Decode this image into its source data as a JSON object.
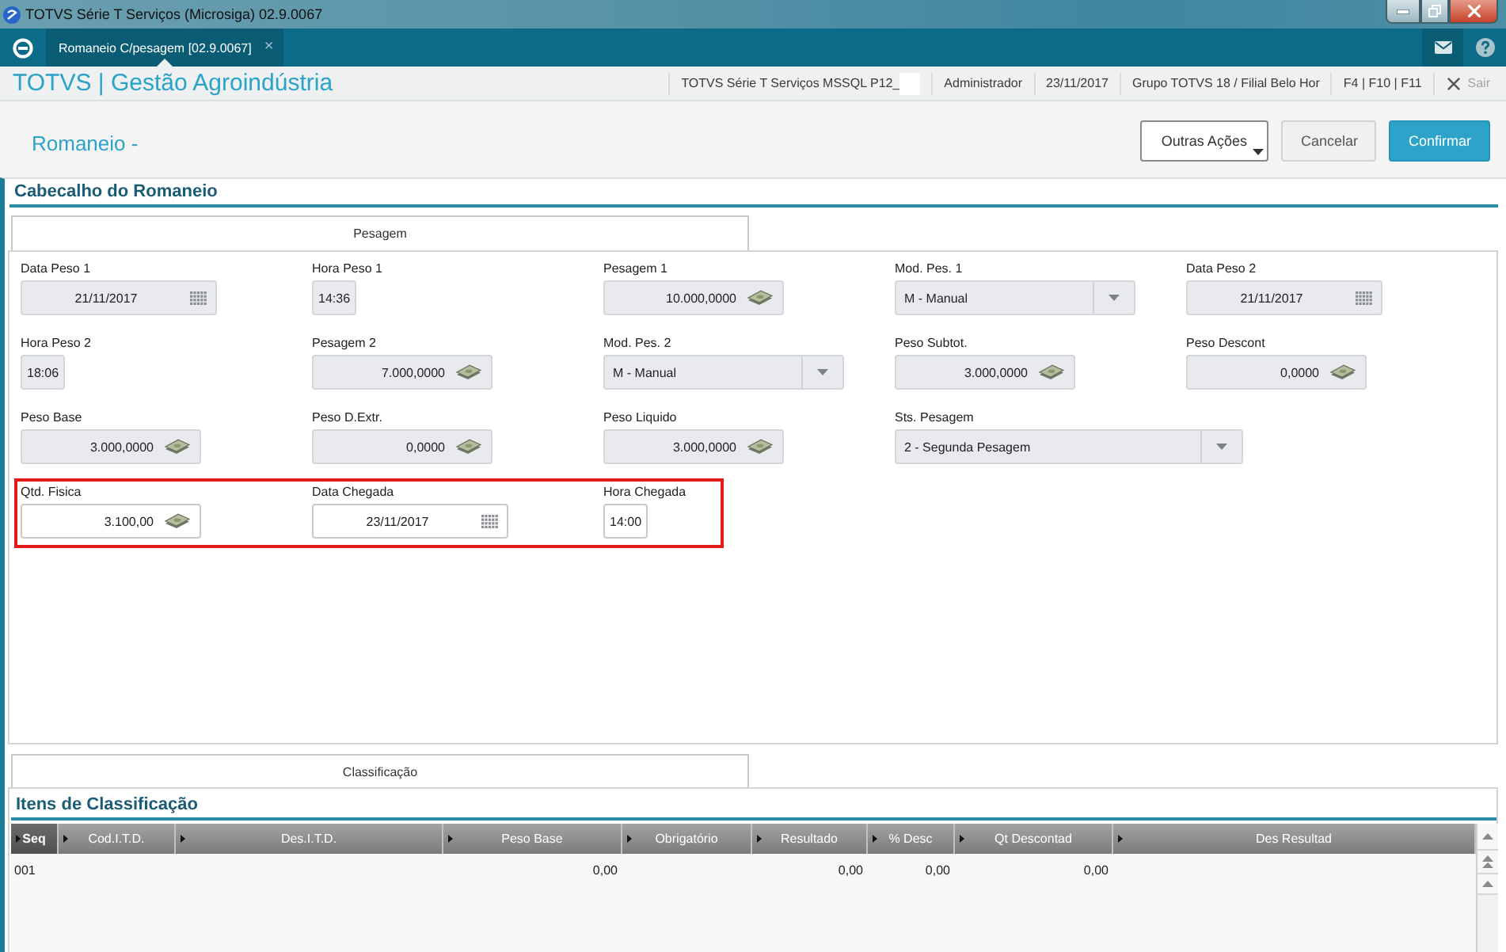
{
  "window": {
    "title": "TOTVS Série T Serviços (Microsiga) 02.9.0067"
  },
  "tabs": [
    {
      "label": "Romaneio C/pesagem [02.9.0067]",
      "close": "×",
      "selected": true
    }
  ],
  "header": {
    "app_title": "TOTVS | Gestão Agroindústria",
    "info": [
      "TOTVS Série T Serviços MSSQL P12_",
      "Administrador",
      "23/11/2017",
      "Grupo TOTVS 18 / Filial Belo Hor",
      "F4 | F10 | F11"
    ],
    "exit": "Sair"
  },
  "page": {
    "title": "Romaneio -",
    "actions": [
      {
        "label": "Outras Ações",
        "kind": "menu"
      },
      {
        "label": "Cancelar",
        "kind": "secondary"
      },
      {
        "label": "Confirmar",
        "kind": "primary"
      }
    ]
  },
  "header_section": {
    "title": "Cabecalho do Romaneio",
    "tab": {
      "label": "Pesagem",
      "selected": true
    },
    "rows": [
      {
        "highlighted": false,
        "fields": [
          {
            "label": "Data Peso 1",
            "value": "21/11/2017",
            "kind": "date",
            "editable": false
          },
          {
            "label": "Hora Peso 1",
            "value": "14:36",
            "kind": "time",
            "editable": false
          },
          {
            "label": "Pesagem 1",
            "value": "10.000,0000",
            "kind": "number",
            "editable": false
          },
          {
            "label": "Mod. Pes. 1",
            "value": "M - Manual",
            "kind": "select",
            "editable": false
          },
          {
            "label": "Data Peso 2",
            "value": "21/11/2017",
            "kind": "date",
            "editable": false
          }
        ]
      },
      {
        "highlighted": false,
        "fields": [
          {
            "label": "Hora Peso 2",
            "value": "18:06",
            "kind": "time",
            "editable": false
          },
          {
            "label": "Pesagem 2",
            "value": "7.000,0000",
            "kind": "number",
            "editable": false
          },
          {
            "label": "Mod. Pes. 2",
            "value": "M - Manual",
            "kind": "select",
            "editable": false
          },
          {
            "label": "Peso Subtot.",
            "value": "3.000,0000",
            "kind": "number",
            "editable": false
          },
          {
            "label": "Peso Descont",
            "value": "0,0000",
            "kind": "number",
            "editable": false
          }
        ]
      },
      {
        "highlighted": false,
        "fields": [
          {
            "label": "Peso Base",
            "value": "3.000,0000",
            "kind": "number",
            "editable": false
          },
          {
            "label": "Peso D.Extr.",
            "value": "0,0000",
            "kind": "number",
            "editable": false
          },
          {
            "label": "Peso Liquido",
            "value": "3.000,0000",
            "kind": "number",
            "editable": false
          },
          {
            "label": "Sts. Pesagem",
            "value": "2 - Segunda Pesagem",
            "kind": "select",
            "editable": false
          }
        ]
      },
      {
        "highlighted": true,
        "fields": [
          {
            "label": "Qtd. Fisica",
            "value": "3.100,00",
            "kind": "number",
            "editable": true
          },
          {
            "label": "Data Chegada",
            "value": "23/11/2017",
            "kind": "date",
            "editable": true
          },
          {
            "label": "Hora Chegada",
            "value": "14:00",
            "kind": "time",
            "editable": true
          }
        ]
      }
    ]
  },
  "items_section": {
    "tab": {
      "label": "Classificação",
      "selected": true
    },
    "title": "Itens de Classificação",
    "table": {
      "columns": [
        {
          "label": "Seq",
          "sorted": true
        },
        {
          "label": "Cod.I.T.D.",
          "sorted": false
        },
        {
          "label": "Des.I.T.D.",
          "sorted": false
        },
        {
          "label": "Peso Base",
          "sorted": false
        },
        {
          "label": "Obrigatório",
          "sorted": false
        },
        {
          "label": "Resultado",
          "sorted": false
        },
        {
          "label": "% Desc",
          "sorted": false
        },
        {
          "label": "Qt Descontad",
          "sorted": false
        },
        {
          "label": "Des Resultad",
          "sorted": false
        }
      ],
      "rows": [
        {
          "cells": [
            "001",
            null,
            null,
            "0,00",
            null,
            "0,00",
            "0,00",
            "0,00",
            null
          ]
        }
      ]
    }
  }
}
